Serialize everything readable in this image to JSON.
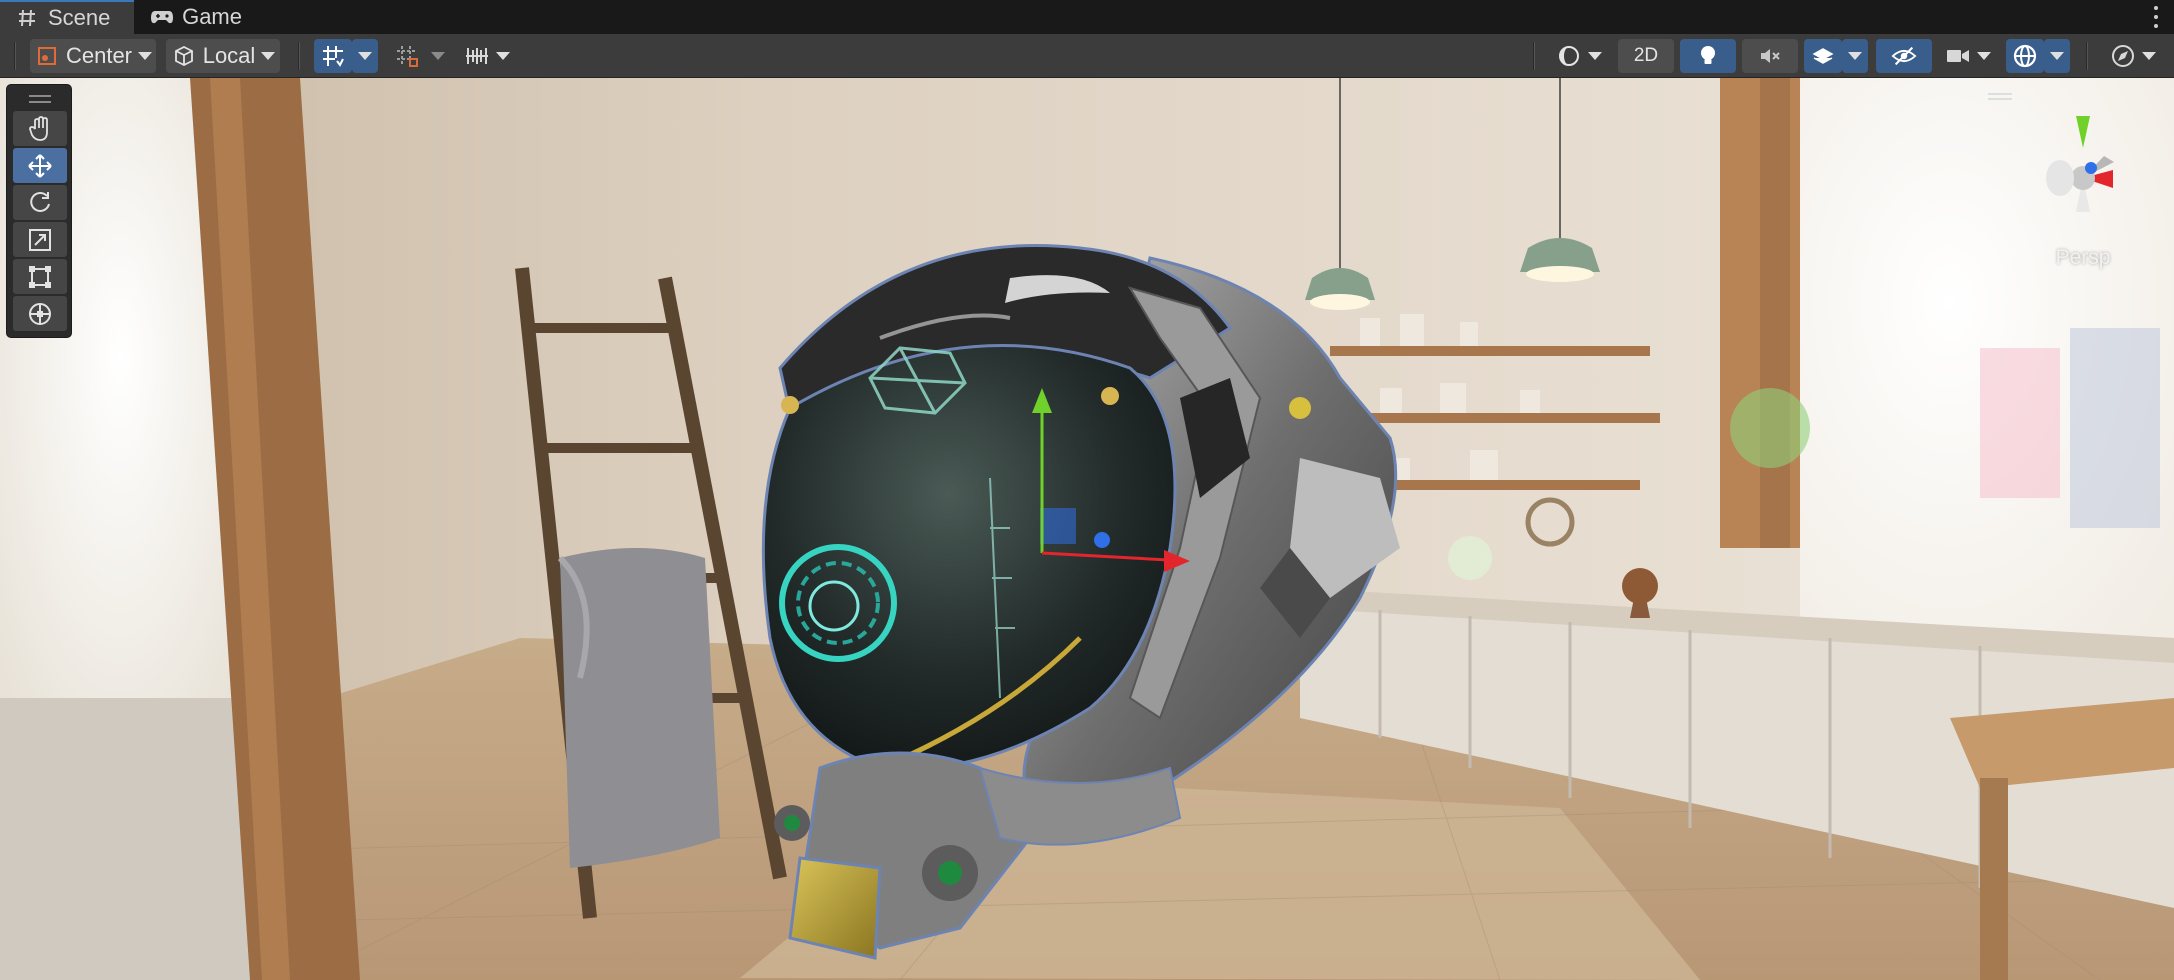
{
  "tabs": {
    "scene": {
      "label": "Scene",
      "icon": "grid-hash-icon"
    },
    "game": {
      "label": "Game",
      "icon": "gamepad-icon"
    }
  },
  "toolbar": {
    "pivot_mode": "Center",
    "pivot_rotation": "Local",
    "mode_2d": "2D"
  },
  "tools": [
    "hand-tool",
    "move-tool",
    "rotate-tool",
    "scale-tool",
    "rect-tool",
    "transform-tool"
  ],
  "active_tool": "move-tool",
  "gizmo": {
    "projection": "Persp"
  },
  "colors": {
    "accent": "#3a79bb",
    "toggle_on": "#3a5e8c",
    "toolbar_bg": "#3c3c3c",
    "x_axis": "#e3262c",
    "y_axis": "#6fd12a",
    "z_axis": "#2f6fe8"
  }
}
